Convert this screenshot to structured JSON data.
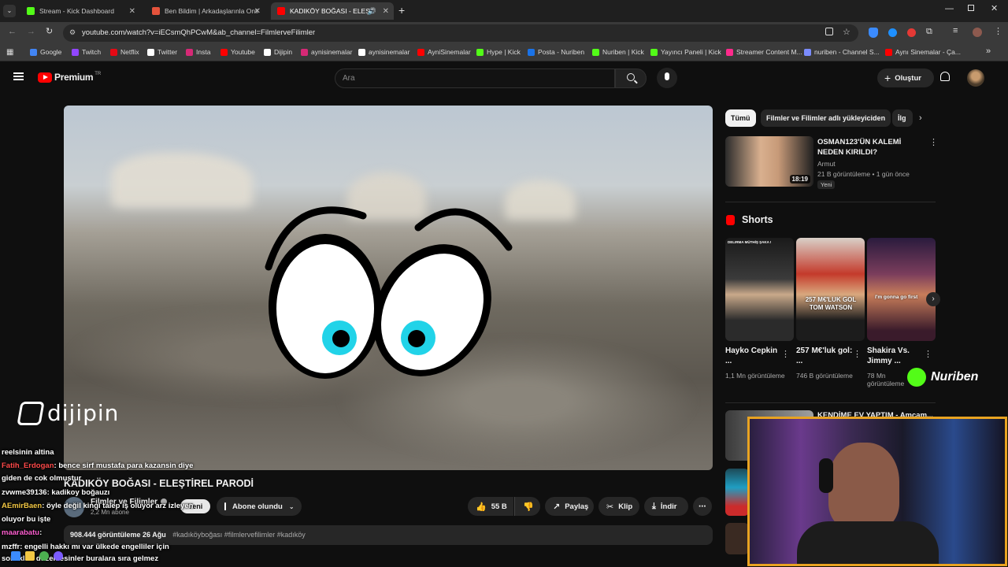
{
  "browser": {
    "tabs": [
      {
        "label": "Stream - Kick Dashboard",
        "color": "#53fc18"
      },
      {
        "label": "Ben Bildim | Arkadaşlarınla Onli",
        "color": "#e5533c"
      },
      {
        "label": "KADIKÖY BOĞASI - ELEŞTİ",
        "color": "#ff0000"
      }
    ],
    "url": "youtube.com/watch?v=iECsmQhPCwM&ab_channel=FilmlerveFilimler",
    "bookmarks": [
      {
        "label": "Google",
        "color": "#4285f4"
      },
      {
        "label": "Twitch",
        "color": "#9146ff"
      },
      {
        "label": "Netflix",
        "color": "#e50914"
      },
      {
        "label": "Twitter",
        "color": "#ffffff"
      },
      {
        "label": "Insta",
        "color": "#d62976"
      },
      {
        "label": "Youtube",
        "color": "#ff0000"
      },
      {
        "label": "Dijipin",
        "color": "#ffffff"
      },
      {
        "label": "aynisinemalar",
        "color": "#d62976"
      },
      {
        "label": "aynisinemalar",
        "color": "#ffffff"
      },
      {
        "label": "AyniSinemalar",
        "color": "#ff0000"
      },
      {
        "label": "Hype | Kick",
        "color": "#53fc18"
      },
      {
        "label": "Posta - Nuriben",
        "color": "#1a73e8"
      },
      {
        "label": "Nuriben | Kick",
        "color": "#53fc18"
      },
      {
        "label": "Yayıncı Paneli | Kick",
        "color": "#53fc18"
      },
      {
        "label": "Streamer Content M...",
        "color": "#ff2a8c"
      },
      {
        "label": "nuriben - Channel S...",
        "color": "#7b8cff"
      },
      {
        "label": "Aynı Sinemalar - Ça...",
        "color": "#ff0000"
      }
    ]
  },
  "youtube": {
    "logo": "Premium",
    "logo_sup": "TR",
    "search_placeholder": "Ara",
    "create_label": "Oluştur",
    "video_title": "KADIKÖY BOĞASI - ELEŞTİREL PARODİ",
    "channel": "Filmler ve Filimler",
    "subscribers": "2,2 Mn abone",
    "subscribed_label": "Abone olundu",
    "likes": "55 B",
    "share_label": "Paylaş",
    "clip_label": "Klip",
    "download_label": "İndir",
    "views_date": "908.444 görüntüleme  26 Ağu",
    "hashtags": "#kadıköyboğası #filmlervefilimler #kadıköy",
    "yeni_badge": "Yeni"
  },
  "sidebar": {
    "chips": [
      "Tümü",
      "Filmler ve Filimler adlı yükleyiciden",
      "İlg"
    ],
    "first_video": {
      "title": "OSMAN123'ÜN KALEMİ NEDEN KIRILDI?",
      "channel": "Armut",
      "meta": "21 B görüntüleme • 1 gün önce",
      "badge": "Yeni",
      "duration": "18:19"
    },
    "shorts_heading": "Shorts",
    "shorts": [
      {
        "title": "Hayko Cepkin ...",
        "views": "1,1 Mn görüntüleme",
        "overlay": "DELIRMA MÜTHİŞ ŞAKA !"
      },
      {
        "title": "257 M€'luk gol: ...",
        "views": "746 B görüntüleme",
        "overlay": "257 M€'LUK GOL TOM WATSON"
      },
      {
        "title": "Shakira Vs. Jimmy ...",
        "views": "78 Mn görüntüleme",
        "overlay": "I'm gonna go first"
      }
    ],
    "next_title": "KENDİME EV YAPTIM - Amcam..."
  },
  "stream": {
    "watermark": "dijipin",
    "brand": "Nuriben"
  },
  "chat": [
    {
      "user": "",
      "text": "reelsinin altina",
      "color": "#ffffff"
    },
    {
      "user": "Fatih_Erdogan",
      "text": ": bence sirf mustafa para kazansin diye",
      "color": "#ff4a4a"
    },
    {
      "user": "",
      "text": "giden de cok olmustur",
      "color": "#ffffff"
    },
    {
      "user": "zvwme39136",
      "text": ": kadikoy boğauzı",
      "color": "#ffffff"
    },
    {
      "user": "AEmirBaen",
      "text": ": öyle değil kingi talep iş oluyor arz izleyen",
      "color": "#f2c744"
    },
    {
      "user": "",
      "text": "oluyor bu işte",
      "color": "#ffffff"
    },
    {
      "user": "maarabatu",
      "text": ":",
      "color": "#ff5fd1"
    },
    {
      "user": "mzffr",
      "text": ": engelli hakkı mı var ülkede engelliler için",
      "color": "#ffffff"
    },
    {
      "user": "",
      "text": "sokakları düzenlesinler buralara sıra gelmez",
      "color": "#ffffff"
    }
  ]
}
